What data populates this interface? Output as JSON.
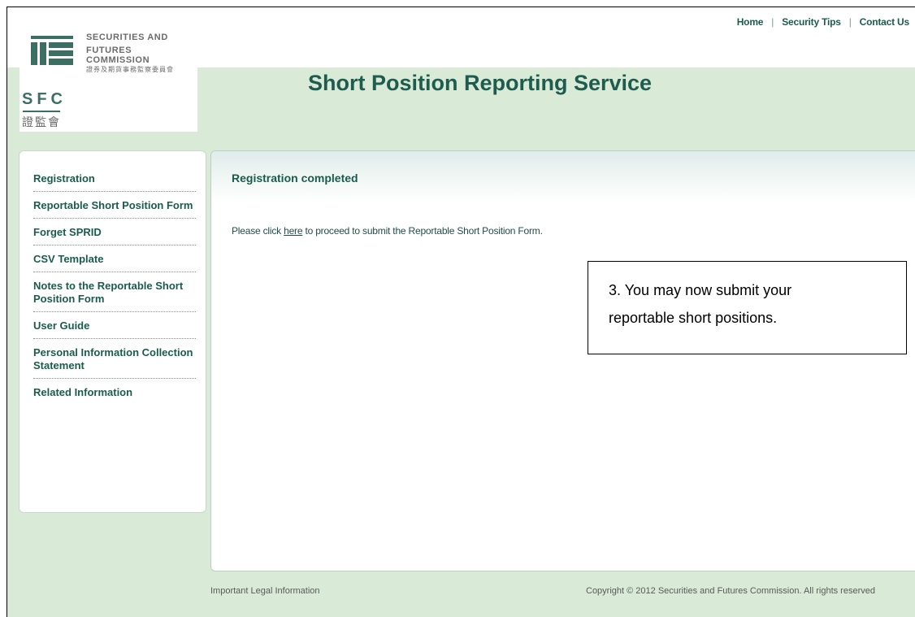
{
  "header": {
    "links": [
      "Home",
      "Security Tips",
      "Contact Us"
    ],
    "separator": "|"
  },
  "logo": {
    "line1": "SECURITIES AND",
    "line2": "FUTURES COMMISSION",
    "cn_full": "證券及期貨事務監察委員會",
    "abbr": "SFC",
    "cn_abbr": "證監會"
  },
  "app": {
    "title": "Short Position Reporting Service"
  },
  "sidebar": {
    "items": [
      {
        "label": "Registration"
      },
      {
        "label": "Reportable Short Position Form"
      },
      {
        "label": "Forget SPRID"
      },
      {
        "label": "CSV Template"
      },
      {
        "label": "Notes to the Reportable Short Position Form"
      },
      {
        "label": "User Guide"
      },
      {
        "label": "Personal Information Collection Statement"
      },
      {
        "label": "Related Information"
      }
    ]
  },
  "content": {
    "title": "Registration completed",
    "message_prefix": "Please click ",
    "link_text": "here",
    "message_suffix": " to proceed to submit the Reportable Short Position Form."
  },
  "callout": {
    "line1": "3. You may now submit your",
    "line2": "reportable short positions."
  },
  "footer": {
    "legal": "Important Legal Information",
    "copyright": "Copyright © 2012 Securities and Futures Commission. All rights reserved"
  },
  "colors": {
    "brand_green": "#1a5c4c",
    "background_green": "#d9ead7"
  }
}
